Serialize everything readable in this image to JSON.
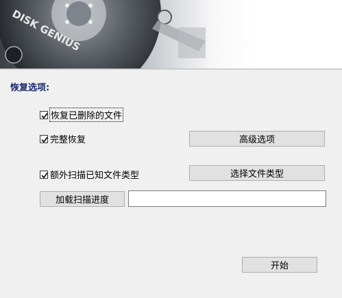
{
  "banner": {
    "brand_text": "DISK GENIUS"
  },
  "section": {
    "title": "恢复选项:"
  },
  "options": {
    "recover_deleted": {
      "label": "恢复已删除的文件",
      "checked": true
    },
    "full_recover": {
      "label": "完整恢复",
      "checked": true
    },
    "extra_scan": {
      "label": "额外扫描已知文件类型",
      "checked": true
    }
  },
  "buttons": {
    "advanced": "高级选项",
    "select_types": "选择文件类型",
    "load_progress": "加载扫描进度",
    "start": "开始"
  },
  "progress_path": {
    "value": ""
  }
}
